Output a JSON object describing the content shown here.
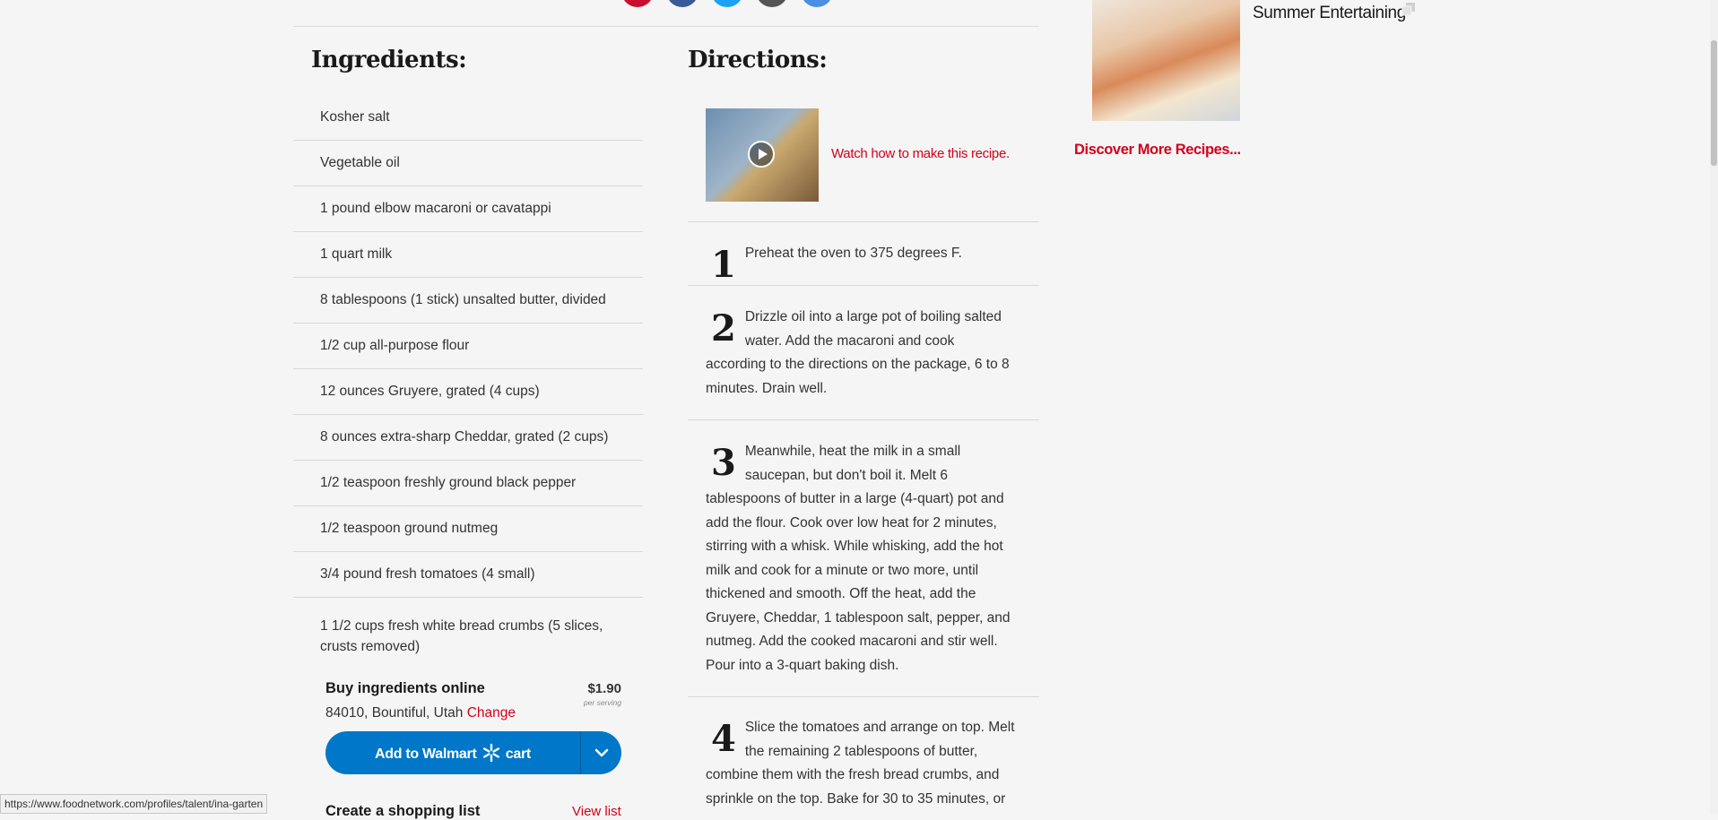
{
  "share": {
    "colors": [
      "#c8102e",
      "#3b5998",
      "#1da1f2",
      "#555555",
      "#4a90e2"
    ]
  },
  "ingredients": {
    "heading": "Ingredients:",
    "items": [
      "Kosher salt",
      "Vegetable oil",
      "1 pound elbow macaroni or cavatappi",
      "1 quart milk",
      "8 tablespoons (1 stick) unsalted butter, divided",
      "1/2 cup all-purpose flour",
      "12 ounces Gruyere, grated (4 cups)",
      "8 ounces extra-sharp Cheddar, grated (2 cups)",
      "1/2 teaspoon freshly ground black pepper",
      "1/2 teaspoon ground nutmeg",
      "3/4 pound fresh tomatoes (4 small)",
      "1 1/2 cups fresh white bread crumbs (5 slices, crusts removed)"
    ]
  },
  "buy": {
    "title": "Buy ingredients online",
    "location": "84010, Bountiful, Utah",
    "change": "Change",
    "price": "$1.90",
    "per_serving": "per serving",
    "walmart_prefix": "Add to Walmart",
    "walmart_suffix": "cart",
    "shopping_list": "Create a shopping list",
    "view_list": "View list"
  },
  "directions": {
    "heading": "Directions:",
    "watch": "Watch how to make this recipe.",
    "steps": [
      {
        "num": "1",
        "text": "Preheat the oven to 375 degrees F."
      },
      {
        "num": "2",
        "text": "Drizzle oil into a large pot of boiling salted water. Add the macaroni and cook according to the directions on the package, 6 to 8 minutes. Drain well."
      },
      {
        "num": "3",
        "text": "Meanwhile, heat the milk in a small saucepan, but don't boil it. Melt 6 tablespoons of butter in a large (4-quart) pot and add the flour. Cook over low heat for 2 minutes, stirring with a whisk. While whisking, add the hot milk and cook for a minute or two more, until thickened and smooth. Off the heat, add the Gruyere, Cheddar, 1 tablespoon salt, pepper, and nutmeg. Add the cooked macaroni and stir well. Pour into a 3-quart baking dish."
      },
      {
        "num": "4",
        "text": "Slice the tomatoes and arrange on top. Melt the remaining 2 tablespoons of butter, combine them with the fresh bread crumbs, and sprinkle on the top. Bake for 30 to 35 minutes, or"
      }
    ]
  },
  "sidebar": {
    "promo_title": "Summer Entertaining",
    "discover": "Discover More Recipes..."
  },
  "status_url": "https://www.foodnetwork.com/profiles/talent/ina-garten"
}
